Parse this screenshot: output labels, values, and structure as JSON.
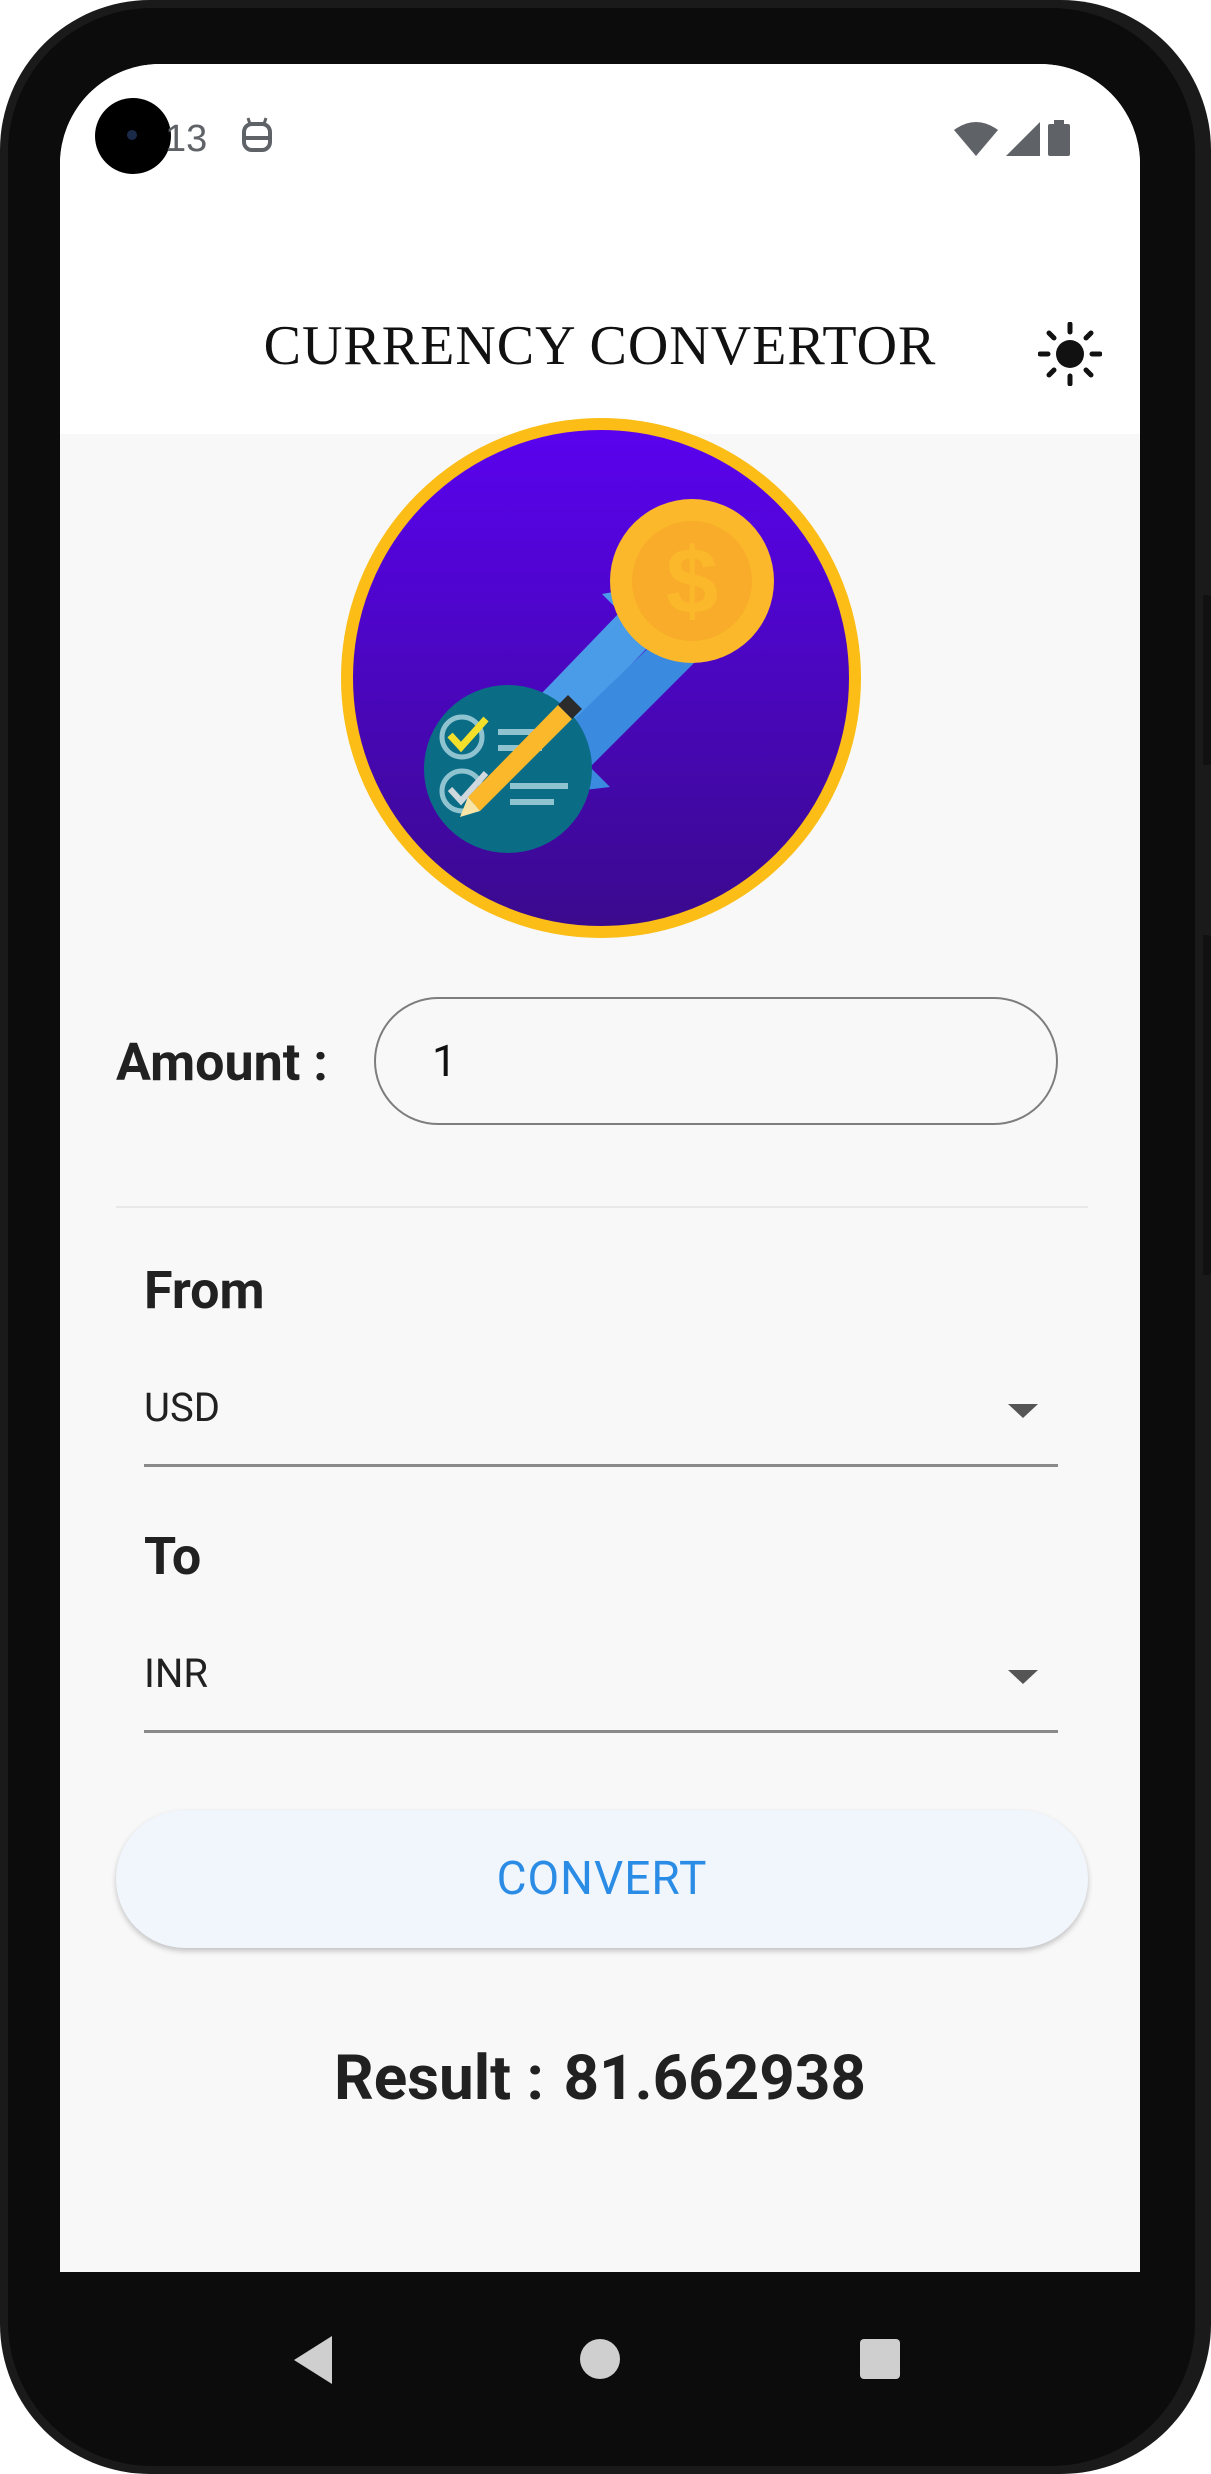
{
  "status": {
    "time": "13"
  },
  "appbar": {
    "title": "CURRENCY CONVERTOR",
    "theme_icon": "sun-icon"
  },
  "logo": {
    "icon": "currency-exchange-logo"
  },
  "form": {
    "amount_label": "Amount :",
    "amount_value": "1",
    "from_label": "From",
    "from_value": "USD",
    "to_label": "To",
    "to_value": "INR",
    "convert_label": "CONVERT"
  },
  "result": {
    "label": "Result :",
    "value": "81.662938"
  },
  "colors": {
    "accent": "#2b8ce6",
    "logo_ring": "#fbbd16",
    "logo_bg_top": "#5a12ea",
    "logo_bg_bottom": "#3a0a8c"
  }
}
